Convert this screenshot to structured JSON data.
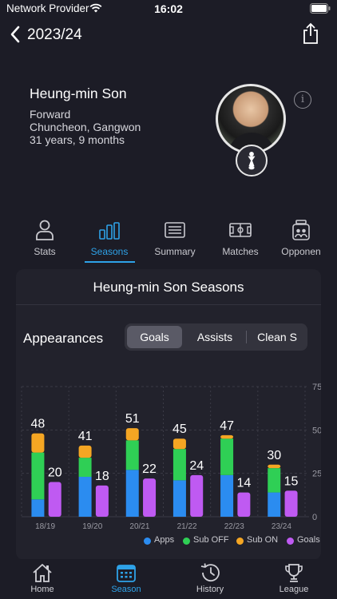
{
  "status": {
    "carrier": "Network Provider",
    "time": "16:02"
  },
  "nav": {
    "title": "2023/24"
  },
  "player": {
    "name": "Heung-min Son",
    "position": "Forward",
    "birthplace": "Chuncheon, Gangwon",
    "age": "31 years, 9 months"
  },
  "tabs": [
    {
      "label": "Stats",
      "icon": "person-icon"
    },
    {
      "label": "Seasons",
      "icon": "bars-icon"
    },
    {
      "label": "Summary",
      "icon": "list-icon"
    },
    {
      "label": "Matches",
      "icon": "pitch-icon"
    },
    {
      "label": "Opponen",
      "icon": "jar-icon"
    }
  ],
  "card": {
    "title": "Heung-min Son Seasons",
    "metric_label": "Appearances",
    "segments": [
      "Goals",
      "Assists",
      "Clean S"
    ],
    "selected_segment": "Goals"
  },
  "chart_data": {
    "type": "bar",
    "categories": [
      "18/19",
      "19/20",
      "20/21",
      "21/22",
      "22/23",
      "23/24"
    ],
    "series": [
      {
        "name": "Apps",
        "color": "#2b8cf0",
        "values": [
          10,
          23,
          27,
          21,
          24,
          14
        ]
      },
      {
        "name": "Sub OFF",
        "color": "#2fcf55",
        "values": [
          27,
          11,
          17,
          18,
          21,
          14
        ]
      },
      {
        "name": "Sub ON",
        "color": "#f5a623",
        "values": [
          11,
          7,
          7,
          6,
          2,
          2
        ]
      },
      {
        "name": "Goals",
        "color": "#bf5af2",
        "values": [
          20,
          18,
          22,
          24,
          14,
          15
        ]
      }
    ],
    "appearance_totals": [
      48,
      41,
      51,
      45,
      47,
      30
    ],
    "yticks": [
      0,
      25,
      50,
      75
    ],
    "ylim": [
      0,
      75
    ],
    "legend_position": "bottom-right",
    "grid": true
  },
  "bottom_tabs": [
    {
      "label": "Home",
      "icon": "home-icon"
    },
    {
      "label": "Season",
      "icon": "calendar-icon"
    },
    {
      "label": "History",
      "icon": "history-icon"
    },
    {
      "label": "League",
      "icon": "trophy-icon"
    }
  ],
  "colors": {
    "accent": "#2ea2e8",
    "background": "#1c1c26",
    "card": "#22222c"
  }
}
